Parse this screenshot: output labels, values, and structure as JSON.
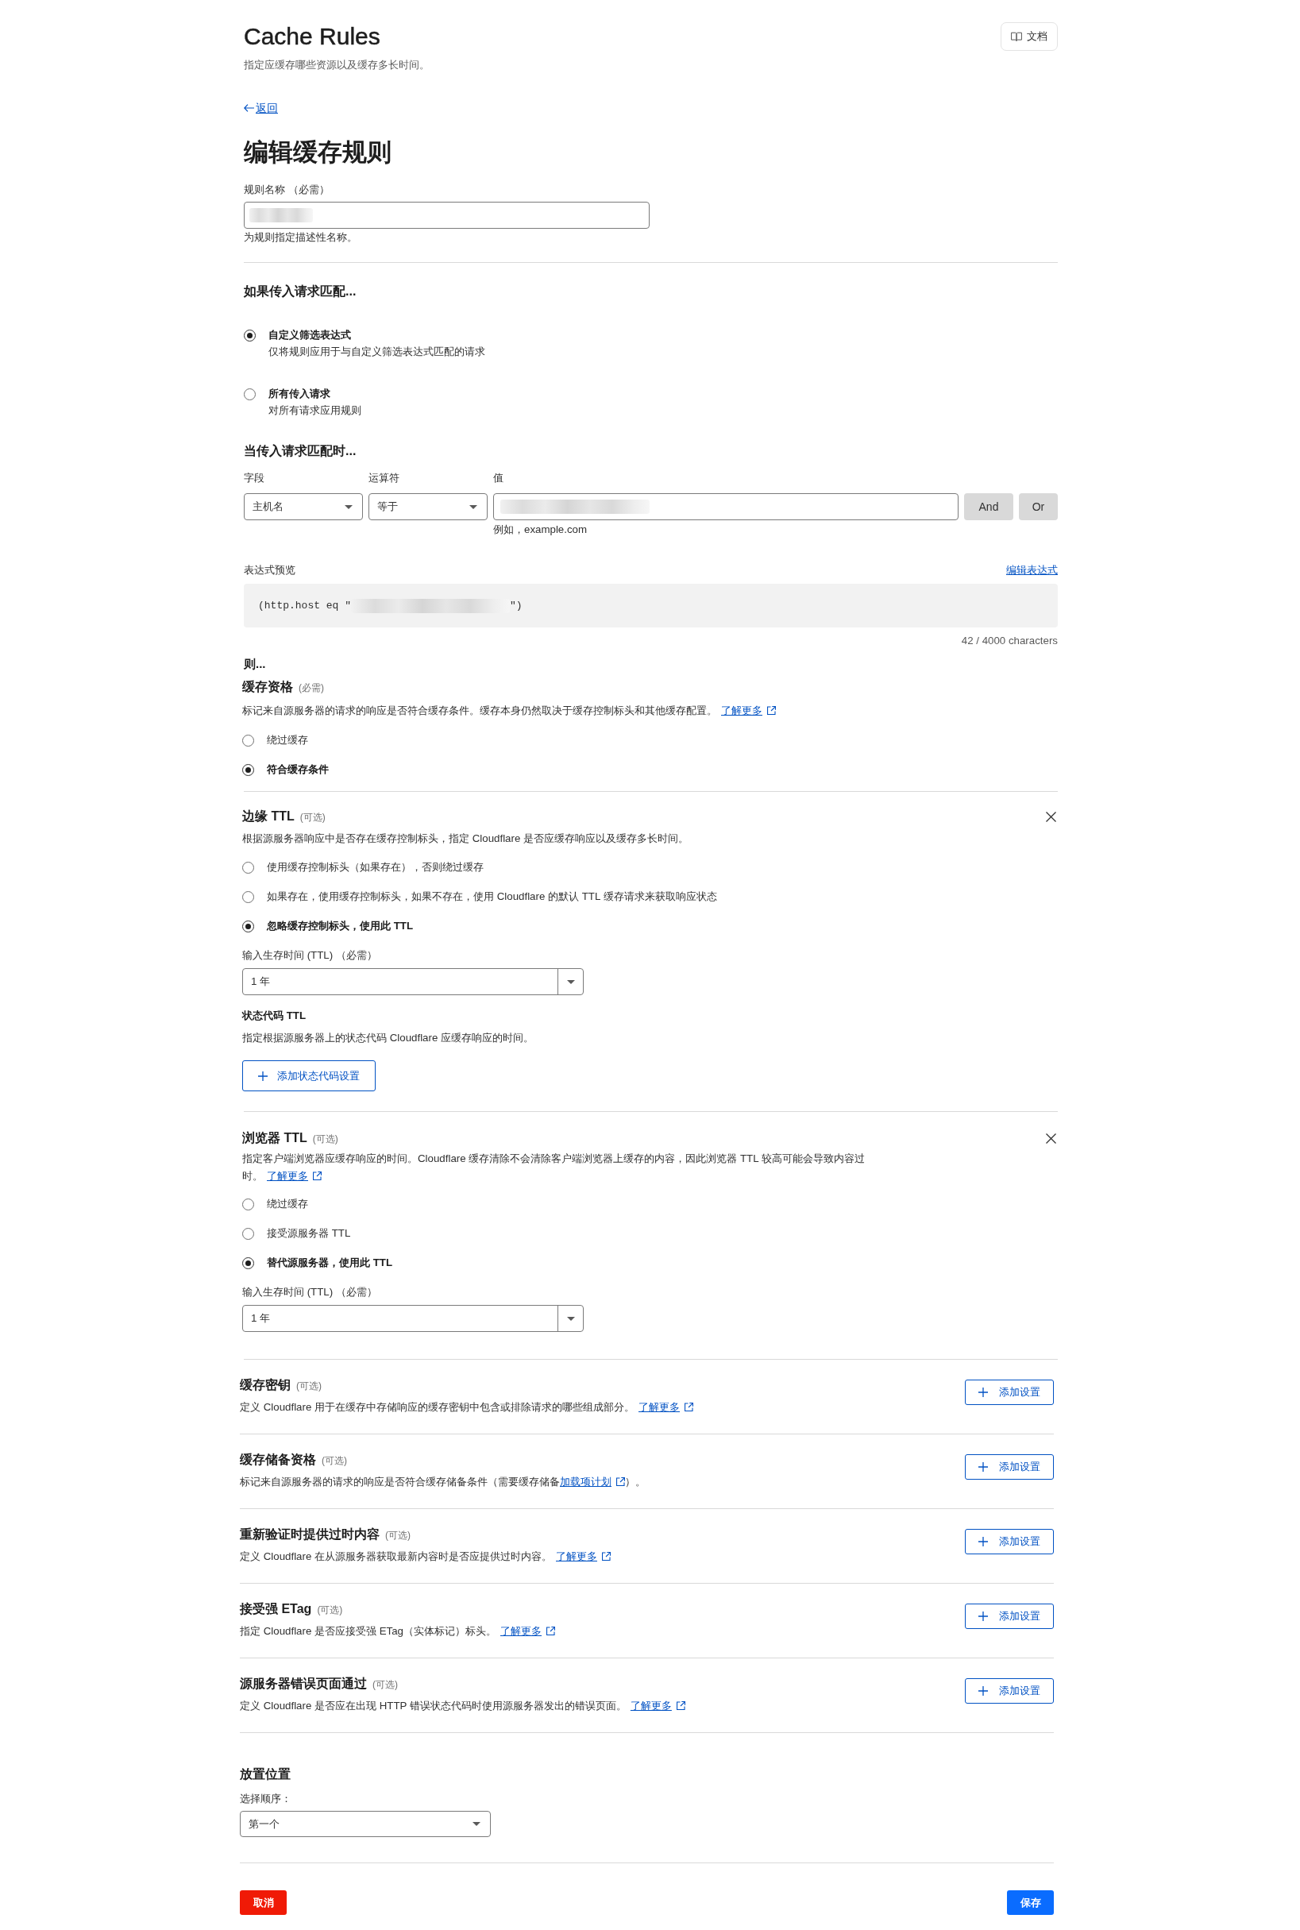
{
  "header": {
    "title": "Cache Rules",
    "subtitle": "指定应缓存哪些资源以及缓存多长时间。",
    "docs_button": "文档"
  },
  "back_link": "返回",
  "heading": "编辑缓存规则",
  "rule_name": {
    "label": "规则名称 （必需）",
    "redacted": true,
    "hint": "为规则指定描述性名称。"
  },
  "match": {
    "title": "如果传入请求匹配...",
    "options": [
      {
        "label": "自定义筛选表达式",
        "description": "仅将规则应用于与自定义筛选表达式匹配的请求",
        "selected": true
      },
      {
        "label": "所有传入请求",
        "description": "对所有请求应用规则",
        "selected": false
      }
    ]
  },
  "expression": {
    "title": "当传入请求匹配时...",
    "columns": [
      "字段",
      "运算符",
      "值"
    ],
    "field": "主机名",
    "operator": "等于",
    "value_redacted": true,
    "value_hint": "例如，example.com",
    "buttons": [
      "And",
      "Or"
    ]
  },
  "preview": {
    "label": "表达式预览",
    "edit_link": "编辑表达式",
    "code_prefix": "(http.host eq \"",
    "redacted": true,
    "code_suffix": "\")",
    "counter": "42 / 4000 characters"
  },
  "then_title": "则...",
  "sections": [
    {
      "title": "缓存资格",
      "tag": "(必需)",
      "closable": false,
      "description": "标记来自源服务器的请求的响应是否符合缓存条件。缓存本身仍然取决于缓存控制标头和其他缓存配置。",
      "link": "了解更多",
      "options": [
        {
          "label": "绕过缓存",
          "selected": false
        },
        {
          "label": "符合缓存条件",
          "selected": true
        }
      ]
    },
    {
      "title": "边缘 TTL",
      "tag": "(可选)",
      "closable": true,
      "description": "根据源服务器响应中是否存在缓存控制标头，指定 Cloudflare 是否应缓存响应以及缓存多长时间。",
      "options": [
        {
          "label": "使用缓存控制标头（如果存在），否则绕过缓存",
          "selected": false
        },
        {
          "label": "如果存在，使用缓存控制标头，如果不存在，使用 Cloudflare 的默认 TTL 缓存请求来获取响应状态",
          "selected": false
        },
        {
          "label": "忽略缓存控制标头，使用此 TTL",
          "selected": true
        }
      ],
      "ttl": {
        "label": "输入生存时间 (TTL) （必需）",
        "value": "1 年"
      },
      "status_codes": {
        "title": "状态代码 TTL",
        "description": "指定根据源服务器上的状态代码 Cloudflare 应缓存响应的时间。",
        "button": "添加状态代码设置"
      }
    },
    {
      "title": "浏览器 TTL",
      "tag": "(可选)",
      "closable": true,
      "description": "指定客户端浏览器应缓存响应的时间。Cloudflare 缓存清除不会清除客户端浏览器上缓存的内容，因此浏览器 TTL 较高可能会导致内容过时。",
      "link": "了解更多",
      "options": [
        {
          "label": "绕过缓存",
          "selected": false
        },
        {
          "label": "接受源服务器 TTL",
          "selected": false
        },
        {
          "label": "替代源服务器，使用此 TTL",
          "selected": true
        }
      ],
      "ttl": {
        "label": "输入生存时间 (TTL) （必需）",
        "value": "1 年"
      }
    }
  ],
  "settings": [
    {
      "title": "缓存密钥",
      "tag": "(可选)",
      "description": "定义 Cloudflare 用于在缓存中存储响应的缓存密钥中包含或排除请求的哪些组成部分。",
      "link": "了解更多",
      "button": "添加设置"
    },
    {
      "title": "缓存储备资格",
      "tag": "(可选)",
      "description": "标记来自源服务器的请求的响应是否符合缓存储备条件（需要缓存储备",
      "link": "加载项计划",
      "after_link": "）。",
      "button": "添加设置"
    },
    {
      "title": "重新验证时提供过时内容",
      "tag": "(可选)",
      "description": "定义 Cloudflare 在从源服务器获取最新内容时是否应提供过时内容。",
      "link": "了解更多",
      "button": "添加设置"
    },
    {
      "title": "接受强 ETag",
      "tag": "(可选)",
      "description": "指定 Cloudflare 是否应接受强 ETag（实体标记）标头。",
      "link": "了解更多",
      "button": "添加设置"
    },
    {
      "title": "源服务器错误页面通过",
      "tag": "(可选)",
      "description": "定义 Cloudflare 是否应在出现 HTTP 错误状态代码时使用源服务器发出的错误页面。",
      "link": "了解更多",
      "button": "添加设置"
    }
  ],
  "placement": {
    "title": "放置位置",
    "label": "选择顺序：",
    "value": "第一个"
  },
  "footer": {
    "cancel": "取消",
    "save": "保存"
  }
}
